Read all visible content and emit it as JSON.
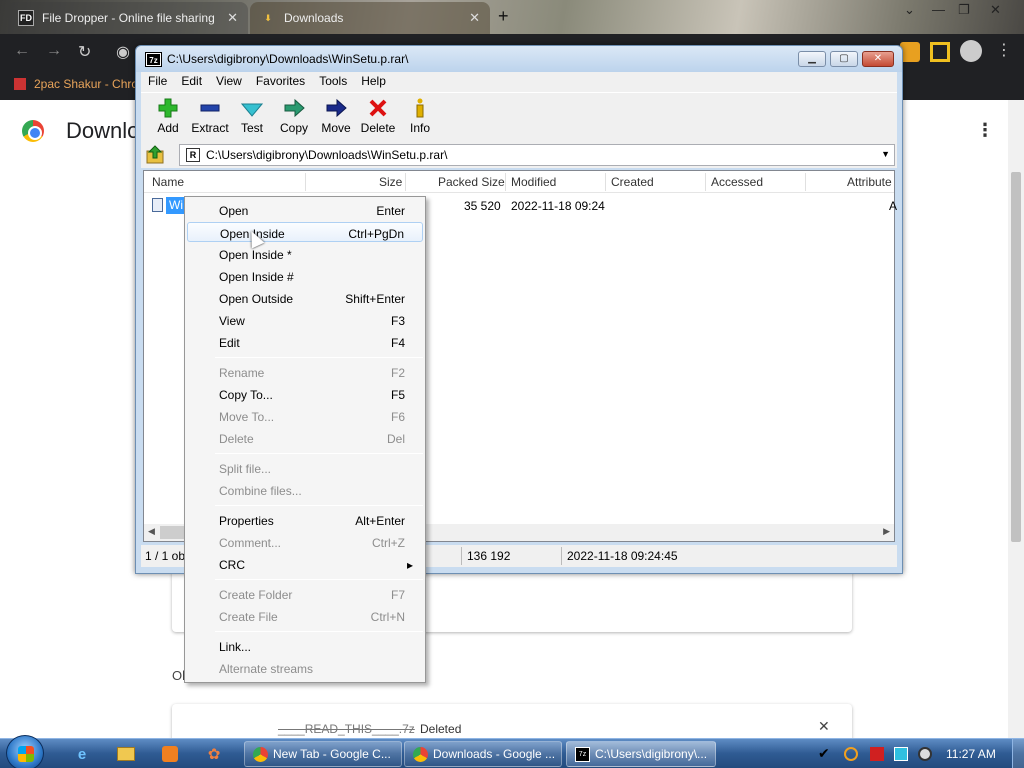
{
  "browser": {
    "tabs": [
      {
        "title": "File Dropper - Online file sharing",
        "icon": "FD"
      },
      {
        "title": "Downloads",
        "icon": "download-icon"
      }
    ],
    "new_tab_label": "+",
    "bookmark": "2pac Shakur - Chro",
    "page_title": "Downlo",
    "older_label": "Ol",
    "download_item": {
      "name": "____READ_THIS____.7z",
      "status": "Deleted"
    }
  },
  "window": {
    "title": "C:\\Users\\digibrony\\Downloads\\WinSetu.p.rar\\",
    "app_icon": "7z",
    "menu": [
      "File",
      "Edit",
      "View",
      "Favorites",
      "Tools",
      "Help"
    ],
    "toolbar": [
      {
        "label": "Add",
        "icon": "plus-icon"
      },
      {
        "label": "Extract",
        "icon": "minus-icon"
      },
      {
        "label": "Test",
        "icon": "check-icon"
      },
      {
        "label": "Copy",
        "icon": "copy-arrow-icon"
      },
      {
        "label": "Move",
        "icon": "move-arrow-icon"
      },
      {
        "label": "Delete",
        "icon": "delete-x-icon"
      },
      {
        "label": "Info",
        "icon": "info-icon"
      }
    ],
    "address": "C:\\Users\\digibrony\\Downloads\\WinSetu.p.rar\\",
    "columns": [
      "Name",
      "Size",
      "Packed Size",
      "Modified",
      "Created",
      "Accessed",
      "Attribute"
    ],
    "row": {
      "name": "Wi",
      "packed": "35 520",
      "modified": "2022-11-18 09:24",
      "attr": "A"
    },
    "status": {
      "selection": "1 / 1 ob",
      "packed": "136 192",
      "modified": "2022-11-18 09:24:45"
    }
  },
  "context_menu": [
    {
      "label": "Open",
      "shortcut": "Enter",
      "disabled": false
    },
    {
      "label": "Open Inside",
      "shortcut": "Ctrl+PgDn",
      "disabled": false,
      "hover": true
    },
    {
      "label": "Open Inside *",
      "shortcut": "",
      "disabled": false
    },
    {
      "label": "Open Inside #",
      "shortcut": "",
      "disabled": false
    },
    {
      "label": "Open Outside",
      "shortcut": "Shift+Enter",
      "disabled": false
    },
    {
      "label": "View",
      "shortcut": "F3",
      "disabled": false
    },
    {
      "label": "Edit",
      "shortcut": "F4",
      "disabled": false
    },
    {
      "label": "Rename",
      "shortcut": "F2",
      "disabled": true
    },
    {
      "label": "Copy To...",
      "shortcut": "F5",
      "disabled": false
    },
    {
      "label": "Move To...",
      "shortcut": "F6",
      "disabled": true
    },
    {
      "label": "Delete",
      "shortcut": "Del",
      "disabled": true
    },
    {
      "label": "Split file...",
      "shortcut": "",
      "disabled": true
    },
    {
      "label": "Combine files...",
      "shortcut": "",
      "disabled": true
    },
    {
      "label": "Properties",
      "shortcut": "Alt+Enter",
      "disabled": false
    },
    {
      "label": "Comment...",
      "shortcut": "Ctrl+Z",
      "disabled": true
    },
    {
      "label": "CRC",
      "shortcut": "▸",
      "disabled": false
    },
    {
      "label": "Create Folder",
      "shortcut": "F7",
      "disabled": true
    },
    {
      "label": "Create File",
      "shortcut": "Ctrl+N",
      "disabled": true
    },
    {
      "label": "Link...",
      "shortcut": "",
      "disabled": false
    },
    {
      "label": "Alternate streams",
      "shortcut": "",
      "disabled": true
    }
  ],
  "taskbar": {
    "tasks": [
      "New Tab - Google C...",
      "Downloads - Google ...",
      "C:\\Users\\digibrony\\..."
    ],
    "clock": "11:27 AM"
  }
}
